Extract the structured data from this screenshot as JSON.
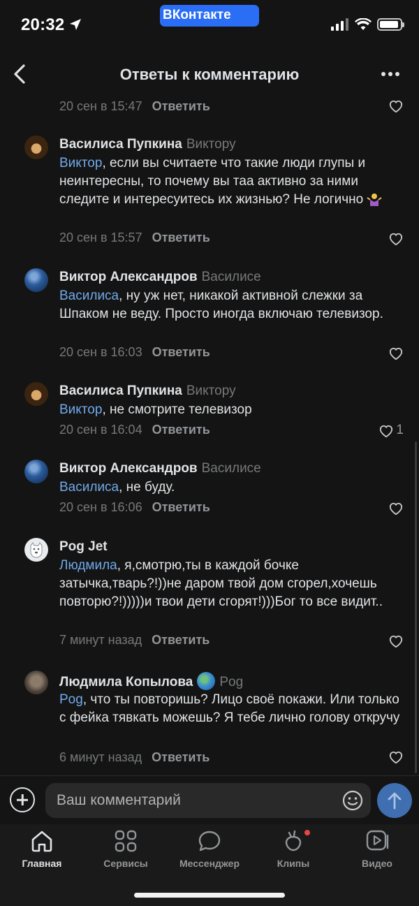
{
  "status": {
    "time": "20:32",
    "app_pill": "Контакте",
    "vk_badge": "В"
  },
  "header": {
    "title": "Ответы к комментарию"
  },
  "reply_label": "Ответить",
  "comments": [
    {
      "author": "",
      "to": "",
      "mention": "",
      "text": "",
      "time": "20 сен в 15:47",
      "likes": ""
    },
    {
      "author": "Василиса Пупкина",
      "to": "Виктору",
      "mention": "Виктор",
      "text": ", если вы считаете что такие люди глупы и неинтересны, то почему вы таа активно за ними следите и интересуитесь их жизнью? Не логично",
      "time": "20 сен в 15:57",
      "likes": ""
    },
    {
      "author": "Виктор Александров",
      "to": "Василисе",
      "mention": "Василиса",
      "text": ", ну уж нет, никакой активной слежки за Шпаком не веду. Просто иногда включаю телевизор.",
      "time": "20 сен в 16:03",
      "likes": ""
    },
    {
      "author": "Василиса Пупкина",
      "to": "Виктору",
      "mention": "Виктор",
      "text": ", не смотрите телевизор",
      "time": "20 сен в 16:04",
      "likes": "1"
    },
    {
      "author": "Виктор Александров",
      "to": "Василисе",
      "mention": "Василиса",
      "text": ", не буду.",
      "time": "20 сен в 16:06",
      "likes": ""
    },
    {
      "author": "Pog Jet",
      "to": "",
      "mention": "Людмила",
      "text": ", я,смотрю,ты в каждой бочке затычка,тварь?!))не даром твой дом сгорел,хочешь повторю?!)))))и твои дети сгорят!)))Бог то все видит..",
      "time": "7 минут назад",
      "likes": ""
    },
    {
      "author": "Людмила Копылова",
      "to": "Pog",
      "mention": "Pog",
      "text": ", что ты повторишь? Лицо своё покажи. Или только с фейка тявкать можешь? Я тебе лично голову откручу",
      "time": "6 минут назад",
      "likes": ""
    }
  ],
  "composer": {
    "placeholder": "Ваш комментарий"
  },
  "tabs": [
    {
      "label": "Главная",
      "icon": "home-icon"
    },
    {
      "label": "Сервисы",
      "icon": "services-icon"
    },
    {
      "label": "Мессенджер",
      "icon": "messenger-icon"
    },
    {
      "label": "Клипы",
      "icon": "clips-icon"
    },
    {
      "label": "Видео",
      "icon": "video-icon"
    }
  ],
  "colors": {
    "background": "#141414",
    "mention": "#71aaeb",
    "accent": "#2b6ef6",
    "badge": "#e64646"
  }
}
